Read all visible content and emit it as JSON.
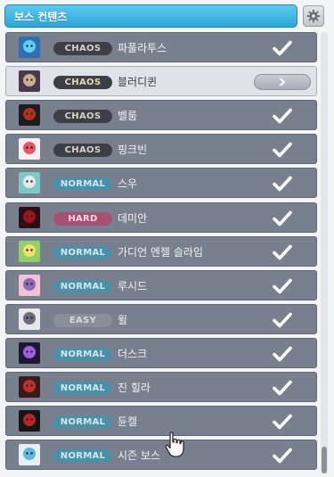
{
  "header": {
    "title": "보스 컨텐츠"
  },
  "bosses": [
    {
      "name": "파풀라투스",
      "difficulty": "CHAOS",
      "level": "chaos",
      "completed": true,
      "avatar_colors": [
        "#2f6fb5",
        "#5bd0f0"
      ]
    },
    {
      "name": "블러디퀸",
      "difficulty": "CHAOS",
      "level": "chaos",
      "completed": false,
      "selected": true,
      "avatar_colors": [
        "#4a3a4e",
        "#c9b090"
      ]
    },
    {
      "name": "벨룸",
      "difficulty": "CHAOS",
      "level": "chaos",
      "completed": true,
      "avatar_colors": [
        "#1c1c22",
        "#a8331e"
      ]
    },
    {
      "name": "핑크빈",
      "difficulty": "CHAOS",
      "level": "chaos",
      "completed": true,
      "avatar_colors": [
        "#f6f0ee",
        "#e6546a"
      ]
    },
    {
      "name": "스우",
      "difficulty": "NORMAL",
      "level": "normal",
      "completed": true,
      "avatar_colors": [
        "#7fc8c8",
        "#e6e8ea"
      ]
    },
    {
      "name": "데미안",
      "difficulty": "HARD",
      "level": "hard",
      "completed": true,
      "avatar_colors": [
        "#2a1014",
        "#9e1420"
      ]
    },
    {
      "name": "가디언 엔젤 슬라임",
      "difficulty": "NORMAL",
      "level": "normal",
      "completed": true,
      "avatar_colors": [
        "#8fd06a",
        "#f2e06c"
      ]
    },
    {
      "name": "루시드",
      "difficulty": "NORMAL",
      "level": "normal",
      "completed": true,
      "avatar_colors": [
        "#f3c2d6",
        "#8c6cb4"
      ]
    },
    {
      "name": "윌",
      "difficulty": "EASY",
      "level": "easy",
      "completed": true,
      "avatar_colors": [
        "#e8e8ea",
        "#6a6e7a"
      ]
    },
    {
      "name": "더스크",
      "difficulty": "NORMAL",
      "level": "normal",
      "completed": true,
      "avatar_colors": [
        "#201636",
        "#a25ee0"
      ]
    },
    {
      "name": "진 힐라",
      "difficulty": "NORMAL",
      "level": "normal",
      "completed": true,
      "avatar_colors": [
        "#3a1a1a",
        "#c0302a"
      ]
    },
    {
      "name": "듄켈",
      "difficulty": "NORMAL",
      "level": "normal",
      "completed": true,
      "avatar_colors": [
        "#151518",
        "#b5252a"
      ]
    },
    {
      "name": "시즌 보스",
      "difficulty": "NORMAL",
      "level": "normal",
      "completed": true,
      "avatar_colors": [
        "#e9eef3",
        "#5cb8e0"
      ]
    }
  ],
  "icons": {
    "settings": "gear-icon",
    "completed": "checkmark-icon",
    "go": "chevron-right-icon",
    "cursor": "hand-pointer-icon"
  },
  "colors": {
    "header_accent": "#2aa6d8",
    "row_bg": "#78808e",
    "selected_row_bg": "#dfe2e6",
    "chaos": "#3c3f46",
    "normal": "#4e8fa8",
    "hard": "#a55173",
    "easy": "#8a9099"
  }
}
